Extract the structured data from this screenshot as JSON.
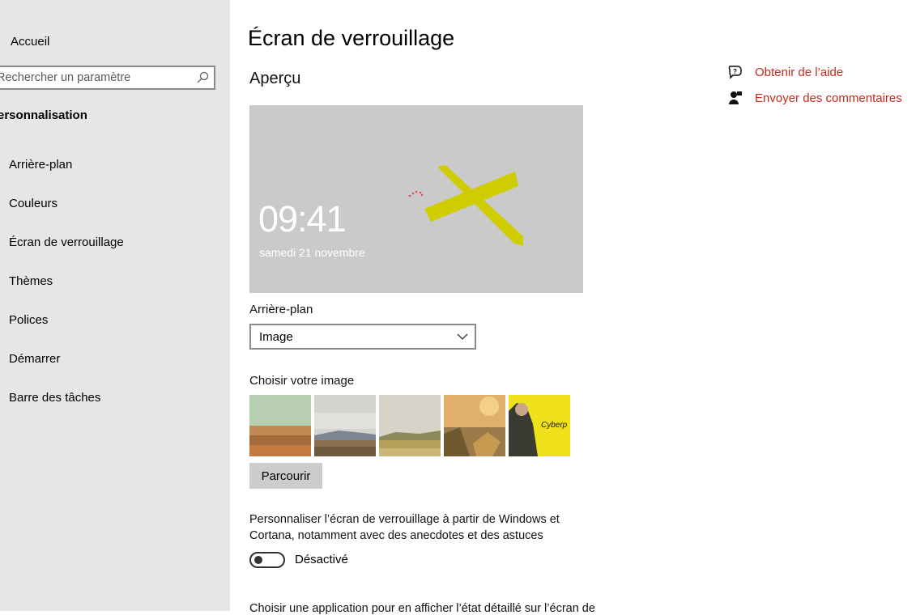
{
  "sidebar": {
    "home_label": "Accueil",
    "search_placeholder": "Rechercher un paramètre",
    "section_title": "Personnalisation",
    "items": [
      {
        "label": "Arrière-plan"
      },
      {
        "label": "Couleurs"
      },
      {
        "label": "Écran de verrouillage"
      },
      {
        "label": "Thèmes"
      },
      {
        "label": "Polices"
      },
      {
        "label": "Démarrer"
      },
      {
        "label": "Barre des tâches"
      }
    ]
  },
  "main": {
    "title": "Écran de verrouillage",
    "preview_heading": "Aperçu",
    "preview": {
      "time": "09:41",
      "date": "samedi 21 novembre"
    },
    "background_label": "Arrière-plan",
    "background_value": "Image",
    "choose_image_label": "Choisir votre image",
    "browse_label": "Parcourir",
    "personalize_text": "Personnaliser l’écran de verrouillage à partir de Windows et Cortana, notamment avec des anecdotes et des astuces",
    "toggle_state": "Désactivé",
    "cut_text": "Choisir une application pour en afficher l’état détaillé sur l’écran de"
  },
  "help": {
    "get_help": "Obtenir de l’aide",
    "feedback": "Envoyer des commentaires"
  },
  "colors": {
    "accent_link": "#c42b1c",
    "sidebar_bg": "#e6e6e6",
    "preview_bg": "#cacaca"
  }
}
